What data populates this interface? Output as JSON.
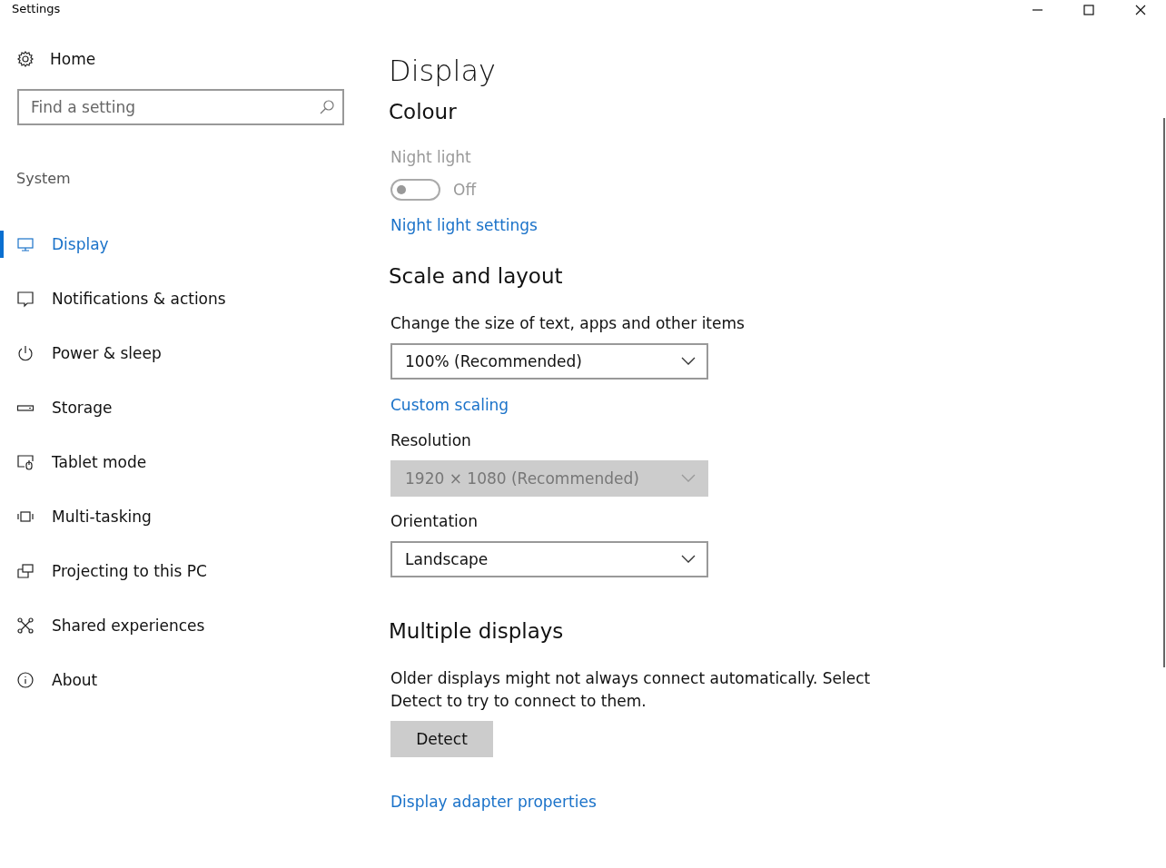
{
  "window": {
    "title": "Settings"
  },
  "sidebar": {
    "home": "Home",
    "search": {
      "placeholder": "Find a setting"
    },
    "section": "System",
    "items": [
      {
        "label": "Display",
        "selected": true
      },
      {
        "label": "Notifications & actions",
        "selected": false
      },
      {
        "label": "Power & sleep",
        "selected": false
      },
      {
        "label": "Storage",
        "selected": false
      },
      {
        "label": "Tablet mode",
        "selected": false
      },
      {
        "label": "Multi-tasking",
        "selected": false
      },
      {
        "label": "Projecting to this PC",
        "selected": false
      },
      {
        "label": "Shared experiences",
        "selected": false
      },
      {
        "label": "About",
        "selected": false
      }
    ]
  },
  "page": {
    "title": "Display",
    "colour": {
      "heading": "Colour",
      "night_light": {
        "label": "Night light",
        "on": false,
        "disabled": true,
        "state_text": "Off"
      },
      "link": "Night light settings"
    },
    "scale": {
      "heading": "Scale and layout",
      "fields": [
        {
          "label": "Change the size of text, apps and other items",
          "value": "100% (Recommended)",
          "disabled": false,
          "link": "Custom scaling"
        },
        {
          "label": "Resolution",
          "value": "1920 × 1080 (Recommended)",
          "disabled": true
        },
        {
          "label": "Orientation",
          "value": "Landscape",
          "disabled": false
        }
      ]
    },
    "multiple": {
      "heading": "Multiple displays",
      "text": "Older displays might not always connect automatically. Select Detect to try to connect to them.",
      "button": "Detect",
      "link": "Display adapter properties"
    }
  }
}
